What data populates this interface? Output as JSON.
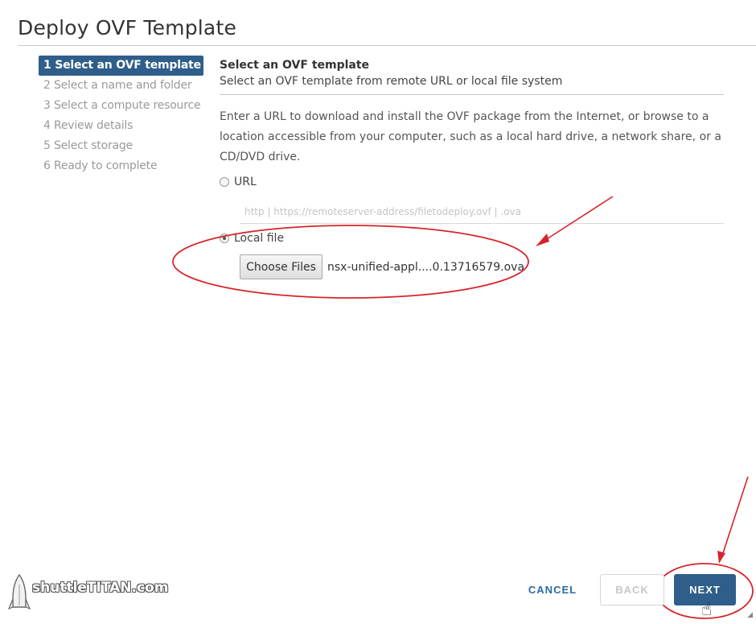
{
  "dialog": {
    "title": "Deploy OVF Template"
  },
  "steps": [
    {
      "label": "1 Select an OVF template",
      "active": true
    },
    {
      "label": "2 Select a name and folder",
      "active": false
    },
    {
      "label": "3 Select a compute resource",
      "active": false
    },
    {
      "label": "4 Review details",
      "active": false
    },
    {
      "label": "5 Select storage",
      "active": false
    },
    {
      "label": "6 Ready to complete",
      "active": false
    }
  ],
  "main": {
    "section_title": "Select an OVF template",
    "section_subtitle": "Select an OVF template from remote URL or local file system",
    "description": "Enter a URL to download and install the OVF package from the Internet, or browse to a location accessible from your computer, such as a local hard drive, a network share, or a CD/DVD drive.",
    "url_option": {
      "label": "URL",
      "checked": false
    },
    "url_input": {
      "value": "",
      "placeholder": "http | https://remoteserver-address/filetodeploy.ovf | .ova"
    },
    "local_option": {
      "label": "Local file",
      "checked": true
    },
    "choose_files_label": "Choose Files",
    "selected_file": "nsx-unified-appl....0.13716579.ova"
  },
  "footer": {
    "cancel_label": "CANCEL",
    "back_label": "BACK",
    "next_label": "NEXT"
  },
  "watermark": {
    "text": "shuttleTITAN.com"
  },
  "colors": {
    "accent": "#2f5e8a",
    "link": "#2d6aa0",
    "annotation": "#d6252a"
  }
}
